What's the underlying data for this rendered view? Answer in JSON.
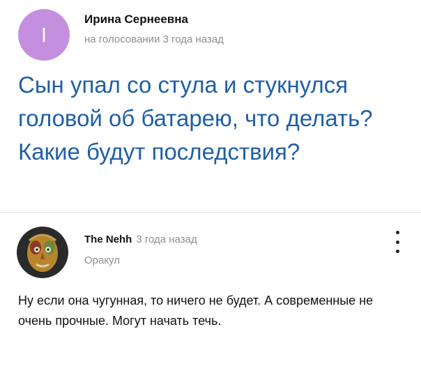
{
  "question": {
    "author_initial": "I",
    "author_name": "Ирина Сернеевна",
    "meta": "на голосовании 3 года назад",
    "title": "Сын упал со стула и стукнулся головой об батарею, что делать? Какие будут последствия?",
    "avatar_color": "#c58fe0",
    "title_color": "#1f5fa6"
  },
  "answer": {
    "author_name": "The Nehh",
    "time": "3 года назад",
    "rank": "Оракул",
    "text": "Ну если она чугунная, то ничего не будет. А современные не очень прочные. Могут начать течь.",
    "more_icon": "vertical-ellipsis-icon"
  }
}
